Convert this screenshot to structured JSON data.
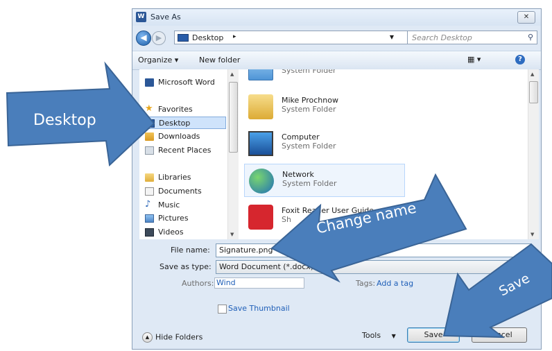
{
  "window": {
    "title": "Save As",
    "app_icon": "word-icon",
    "close_glyph": "✕"
  },
  "address": {
    "location": "Desktop",
    "separator": "▸",
    "search_placeholder": "Search Desktop"
  },
  "toolbar": {
    "organize": "Organize ▾",
    "new_folder": "New folder",
    "views": "▦ ▾",
    "help": "?"
  },
  "nav": {
    "items": [
      {
        "label": "Microsoft Word",
        "icon": "word-doc-icon"
      },
      {
        "label": "Favorites",
        "icon": "star-icon"
      },
      {
        "label": "Desktop",
        "icon": "desktop-icon",
        "selected": true
      },
      {
        "label": "Downloads",
        "icon": "downloads-icon"
      },
      {
        "label": "Recent Places",
        "icon": "recent-places-icon"
      },
      {
        "label": "Libraries",
        "icon": "libraries-icon"
      },
      {
        "label": "Documents",
        "icon": "documents-icon"
      },
      {
        "label": "Music",
        "icon": "music-icon"
      },
      {
        "label": "Pictures",
        "icon": "pictures-icon"
      },
      {
        "label": "Videos",
        "icon": "videos-icon"
      }
    ]
  },
  "files": [
    {
      "name": "",
      "type": "System Folder",
      "icon": "folder-icon"
    },
    {
      "name": "Mike Prochnow",
      "type": "System Folder",
      "icon": "user-folder-icon"
    },
    {
      "name": "Computer",
      "type": "System Folder",
      "icon": "computer-icon"
    },
    {
      "name": "Network",
      "type": "System Folder",
      "icon": "network-icon"
    },
    {
      "name": "Foxit Reader User Guide",
      "type": "Sh",
      "icon": "foxit-shortcut-icon"
    }
  ],
  "form": {
    "file_name_label": "File name:",
    "file_name_value": "Signature.png",
    "save_type_label": "Save as type:",
    "save_type_value": "Word Document (*.docx)",
    "authors_label": "Authors:",
    "authors_value": "Wind",
    "tags_label": "Tags:",
    "tags_value": "Add a tag",
    "thumbnail_label": "Save Thumbnail"
  },
  "footer": {
    "hide_folders": "Hide Folders",
    "tools": "Tools",
    "save": "Save",
    "cancel": "Cancel"
  },
  "callouts": {
    "desktop": "Desktop",
    "change_name": "Change name",
    "save": "Save",
    "color": "#4a7ebb"
  }
}
